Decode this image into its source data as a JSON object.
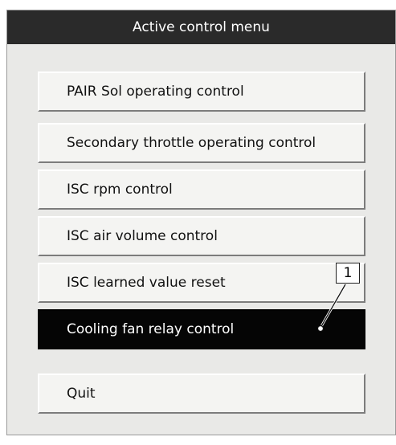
{
  "window": {
    "title": "Active control menu"
  },
  "menu": {
    "items": [
      {
        "label": "PAIR Sol operating control"
      },
      {
        "label": "Secondary throttle operating control"
      },
      {
        "label": "ISC rpm control"
      },
      {
        "label": "ISC air volume control"
      },
      {
        "label": "ISC learned value reset"
      },
      {
        "label": "Cooling fan relay control",
        "selected": true
      }
    ],
    "quit_label": "Quit"
  },
  "callout": {
    "number": "1"
  }
}
